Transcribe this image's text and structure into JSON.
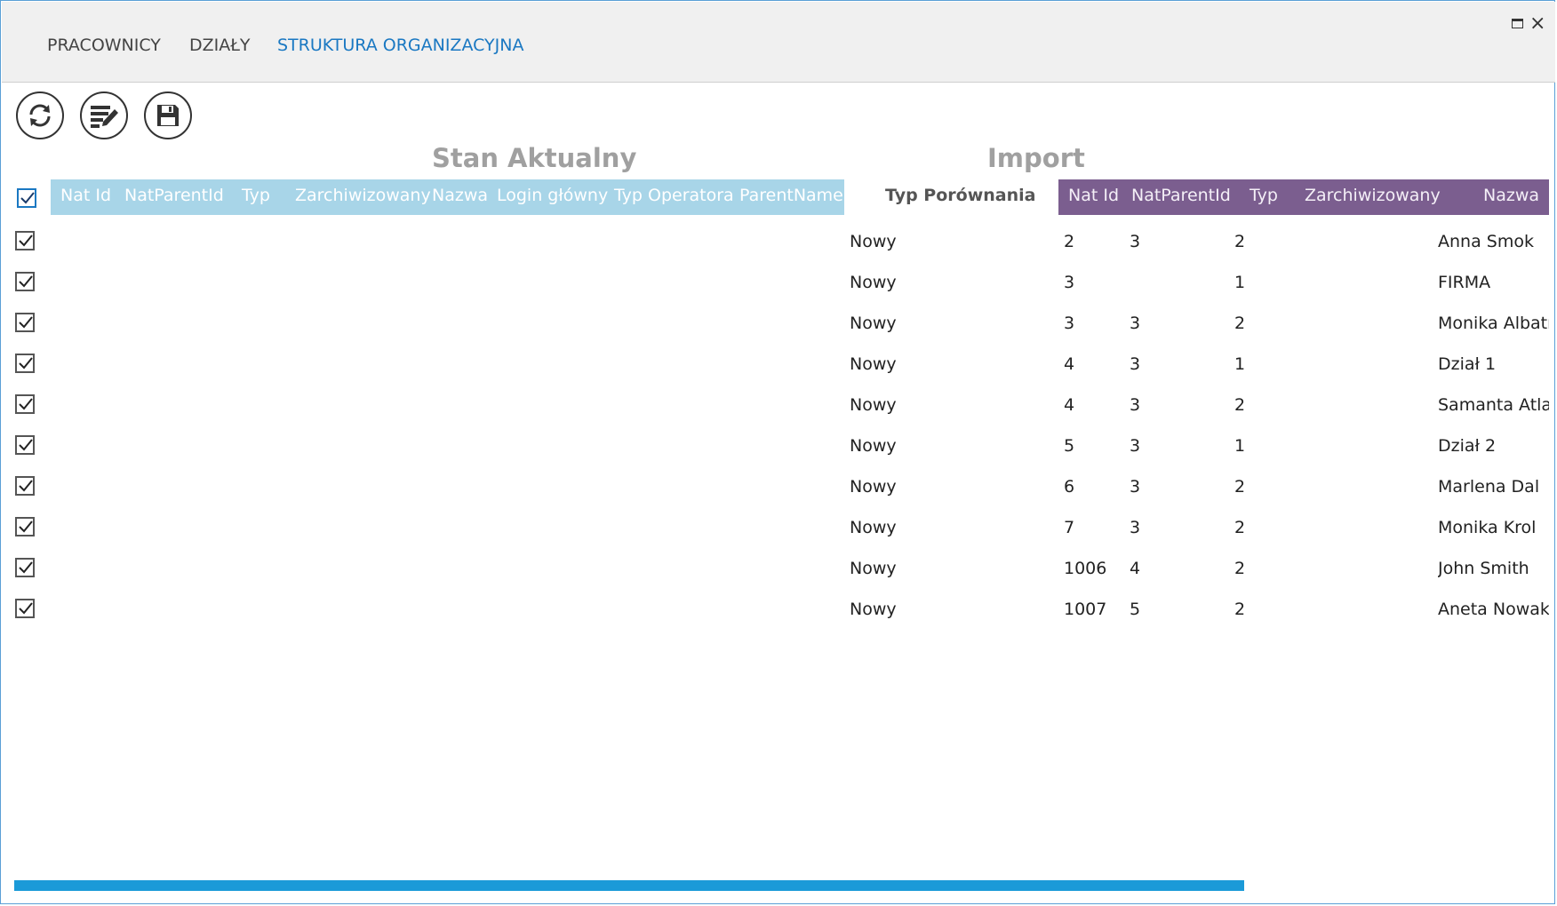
{
  "tabs": [
    {
      "label": "PRACOWNICY",
      "active": false
    },
    {
      "label": "DZIAŁY",
      "active": false
    },
    {
      "label": "STRUKTURA ORGANIZACYJNA",
      "active": true
    }
  ],
  "window_buttons": {
    "maximize": "maximize-icon",
    "close": "×"
  },
  "toolbar": [
    {
      "icon": "refresh-icon"
    },
    {
      "icon": "edit-list-icon"
    },
    {
      "icon": "save-icon"
    }
  ],
  "sections": {
    "left_title": "Stan Aktualny",
    "right_title": "Import",
    "compare_header": "Typ Porównania"
  },
  "left_columns": [
    "Nat Id",
    "NatParentId",
    "Typ",
    "Zarchiwizowany",
    "Nazwa",
    "Login główny",
    "Typ Operatora",
    "ParentName"
  ],
  "right_columns": [
    "Nat Id",
    "NatParentId",
    "Typ",
    "Zarchiwizowany",
    "Nazwa"
  ],
  "select_all_checked": true,
  "rows": [
    {
      "checked": true,
      "compare": "Nowy",
      "nat_id": "2",
      "parent": "3",
      "typ": "2",
      "zarch": "",
      "nazwa": "Anna Smok"
    },
    {
      "checked": true,
      "compare": "Nowy",
      "nat_id": "3",
      "parent": "",
      "typ": "1",
      "zarch": "",
      "nazwa": "FIRMA"
    },
    {
      "checked": true,
      "compare": "Nowy",
      "nat_id": "3",
      "parent": "3",
      "typ": "2",
      "zarch": "",
      "nazwa": "Monika Albatr"
    },
    {
      "checked": true,
      "compare": "Nowy",
      "nat_id": "4",
      "parent": "3",
      "typ": "1",
      "zarch": "",
      "nazwa": "Dział 1"
    },
    {
      "checked": true,
      "compare": "Nowy",
      "nat_id": "4",
      "parent": "3",
      "typ": "2",
      "zarch": "",
      "nazwa": "Samanta Atlas"
    },
    {
      "checked": true,
      "compare": "Nowy",
      "nat_id": "5",
      "parent": "3",
      "typ": "1",
      "zarch": "",
      "nazwa": "Dział 2"
    },
    {
      "checked": true,
      "compare": "Nowy",
      "nat_id": "6",
      "parent": "3",
      "typ": "2",
      "zarch": "",
      "nazwa": "Marlena Dal"
    },
    {
      "checked": true,
      "compare": "Nowy",
      "nat_id": "7",
      "parent": "3",
      "typ": "2",
      "zarch": "",
      "nazwa": "Monika Krol"
    },
    {
      "checked": true,
      "compare": "Nowy",
      "nat_id": "1006",
      "parent": "4",
      "typ": "2",
      "zarch": "",
      "nazwa": "John Smith"
    },
    {
      "checked": true,
      "compare": "Nowy",
      "nat_id": "1007",
      "parent": "5",
      "typ": "2",
      "zarch": "",
      "nazwa": "Aneta Nowak"
    }
  ],
  "colors": {
    "accent": "#1a78c2",
    "left_header": "#a8d5e8",
    "right_header": "#7b5e8f",
    "scrollbar": "#1b9ad8"
  }
}
